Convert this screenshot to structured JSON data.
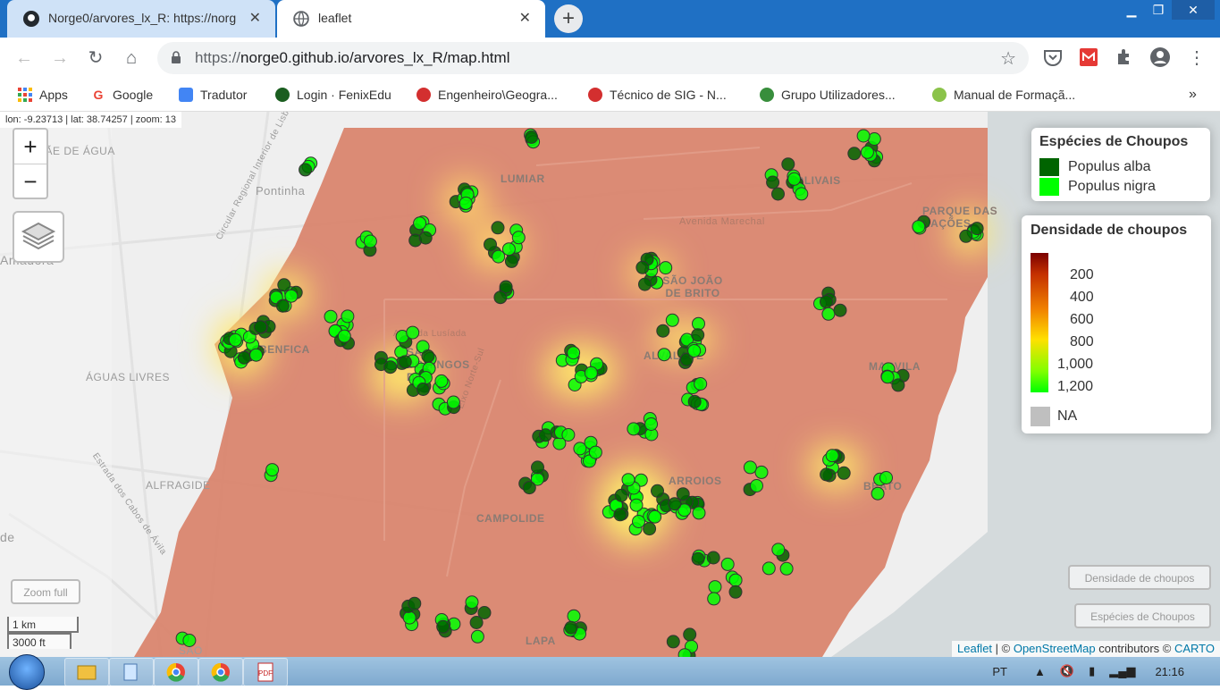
{
  "browser": {
    "tabs": [
      {
        "title": "Norge0/arvores_lx_R: https://norg",
        "active": false
      },
      {
        "title": "leaflet",
        "active": true
      }
    ],
    "url_prefix": "https://",
    "url": "norge0.github.io/arvores_lx_R/map.html",
    "bookmarks": [
      {
        "label": "Apps",
        "color": "#4285f4"
      },
      {
        "label": "Google",
        "color": "#ea4335"
      },
      {
        "label": "Tradutor",
        "color": "#4285f4"
      },
      {
        "label": "Login · FenixEdu",
        "color": "#1b5e20"
      },
      {
        "label": "Engenheiro\\Geogra...",
        "color": "#d32f2f"
      },
      {
        "label": "Técnico de SIG - N...",
        "color": "#d32f2f"
      },
      {
        "label": "Grupo Utilizadores...",
        "color": "#388e3c"
      },
      {
        "label": "Manual de Formaçã...",
        "color": "#8bc34a"
      }
    ]
  },
  "map": {
    "coords_readout": "lon: -9.23713 | lat: 38.74257 | zoom: 13",
    "zoom_in": "+",
    "zoom_out": "−",
    "zoom_full": "Zoom full",
    "scale_km": "1 km",
    "scale_ft": "3000 ft",
    "place_labels": {
      "lumiar": "LUMIAR",
      "olivais": "OLIVAIS",
      "parque_das_nacoes": "PARQUE DAS NAÇÕES",
      "benfica": "BENFICA",
      "sao_domingos": "SÃO DOMINGOS DE",
      "sao": "SÃO",
      "alvalade": "ALVALADE",
      "marvila": "MARVILA",
      "sao_joao_de_brito": "SÃO JOÃO DE BRITO",
      "aguas_livres": "ÁGUAS LIVRES",
      "alfragide": "ALFRAGIDE",
      "campolide": "CAMPOLIDE",
      "arroios": "ARROIOS",
      "beato": "BEATO",
      "lapa": "LAPA",
      "pontinha": "Pontinha",
      "amadora": "Amadora",
      "mae_de_agua": "MÃE DE ÁGUA",
      "de": "de",
      "sao_bottom": "SÃO"
    },
    "road_labels": {
      "avenida_lusiada": "Avenida Lusíada",
      "avenida_marechal": "Avenida Marechal",
      "eixo_norte_sul": "Eixo Norte-Sul",
      "circular_regional": "Circular Regional Interior de Lisboa",
      "estrada_cabos": "Estrada dos Cabos de Ávila"
    },
    "legend_species": {
      "title": "Espécies de Choupos",
      "items": [
        {
          "label": "Populus alba",
          "color": "#006400"
        },
        {
          "label": "Populus nigra",
          "color": "#00ff00"
        }
      ]
    },
    "legend_density": {
      "title": "Densidade de choupos",
      "ticks": [
        "200",
        "400",
        "600",
        "800",
        "1,000",
        "1,200"
      ],
      "na_label": "NA"
    },
    "toggle_density": "Densidade de choupos",
    "toggle_species": "Espécies de Choupos",
    "attribution": {
      "leaflet": "Leaflet",
      "sep": " | © ",
      "osm": "OpenStreetMap",
      "contrib": " contributors © ",
      "carto": "CARTO"
    }
  },
  "taskbar": {
    "lang": "PT",
    "time": "21:16"
  }
}
